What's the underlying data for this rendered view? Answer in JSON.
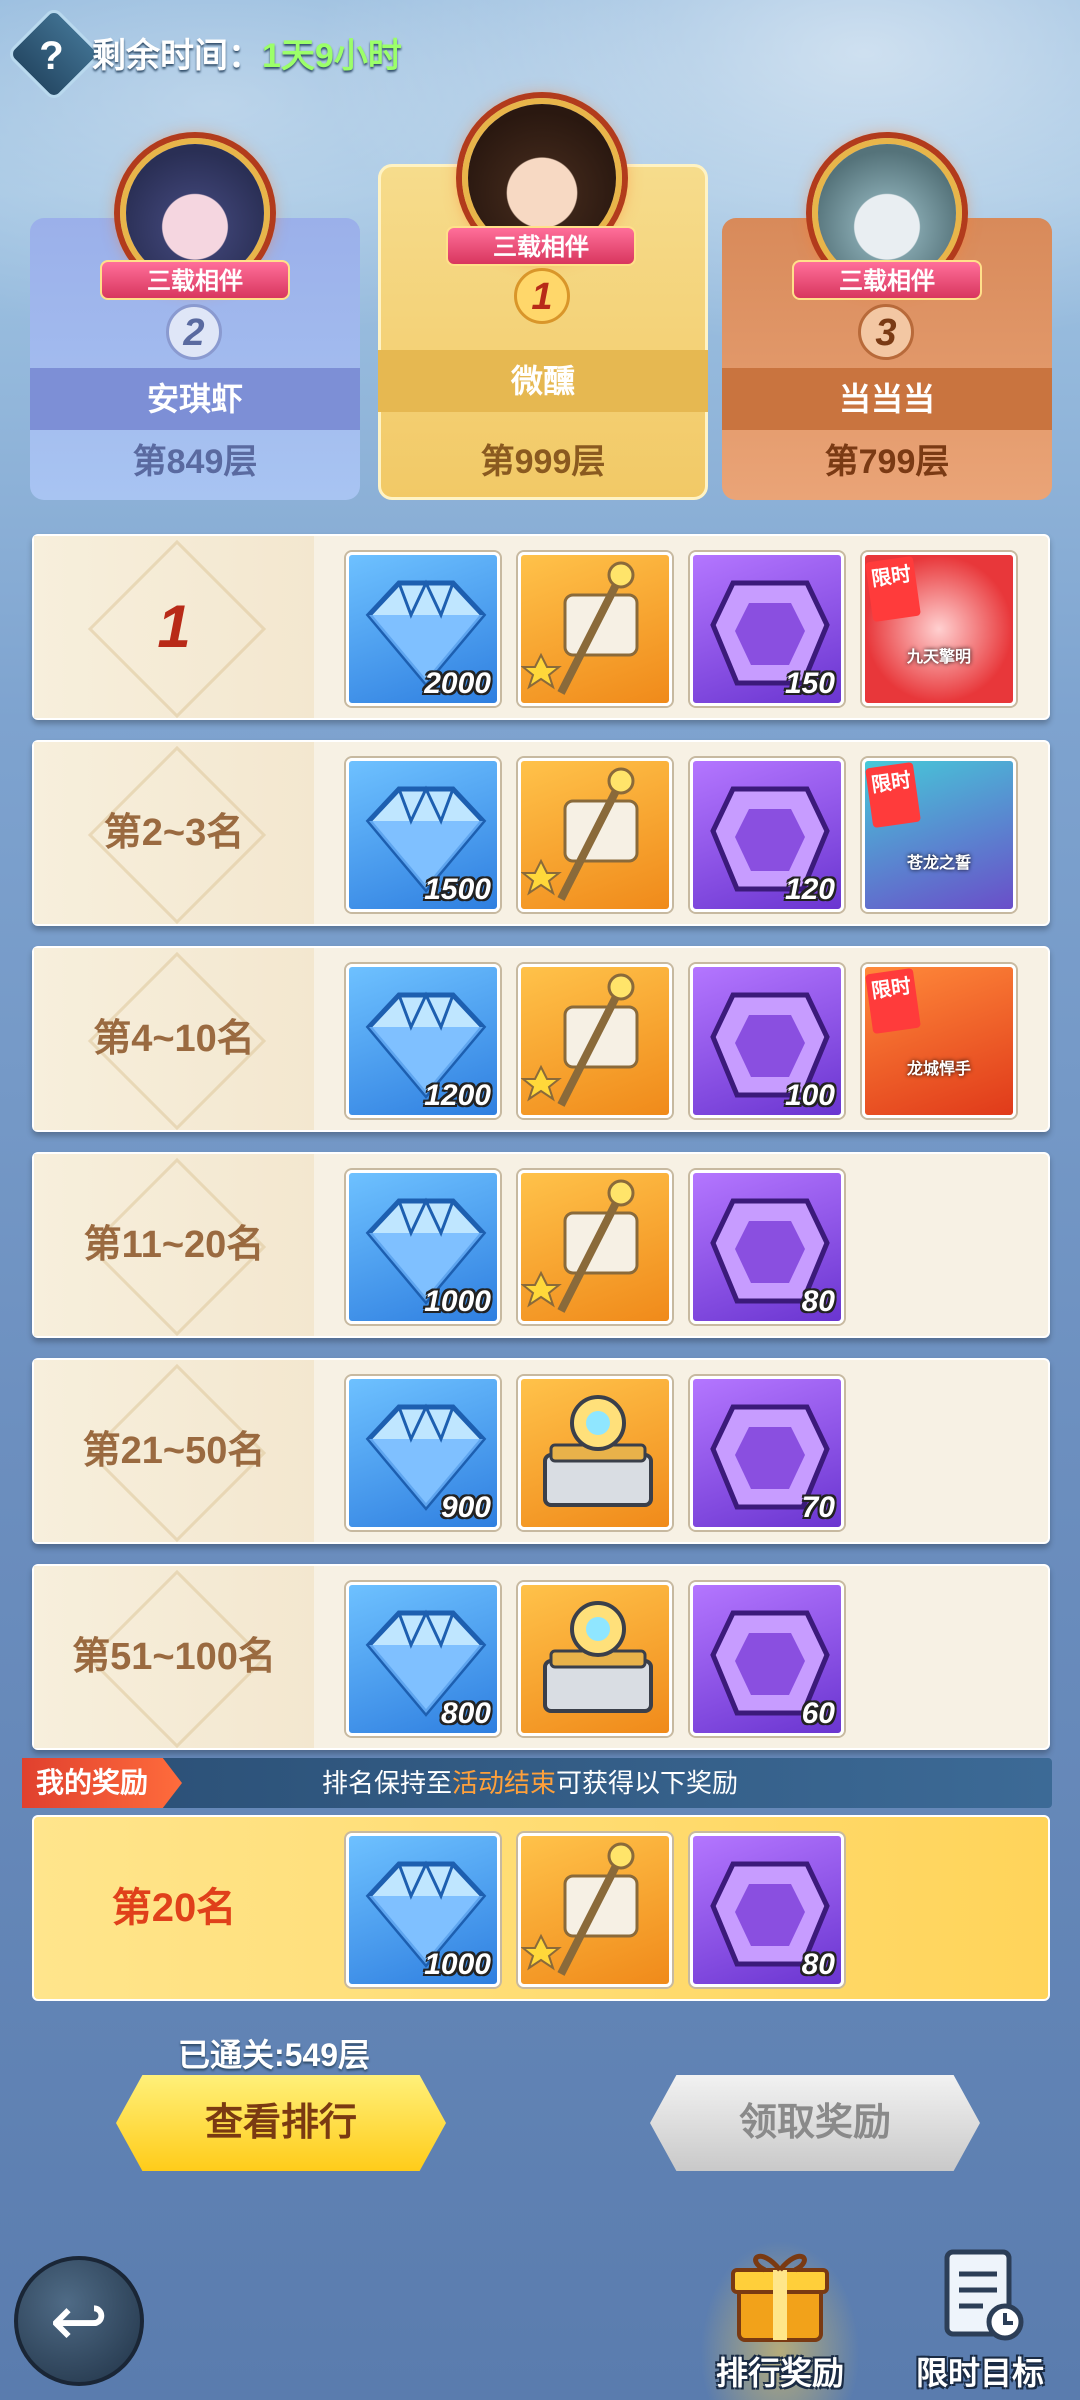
{
  "header": {
    "help_icon": "question-icon",
    "timer_label": "剩余时间：",
    "timer_value": "1天9小时"
  },
  "podium": [
    {
      "rank": "2",
      "banner": "三载相伴",
      "name": "安琪虾",
      "floor": "第849层"
    },
    {
      "rank": "1",
      "banner": "三载相伴",
      "name": "微醺",
      "floor": "第999层"
    },
    {
      "rank": "3",
      "banner": "三载相伴",
      "name": "当当当",
      "floor": "第799层"
    }
  ],
  "rewards": [
    {
      "rank_label": "1",
      "items": [
        {
          "kind": "diamond",
          "count": "2000"
        },
        {
          "kind": "scroll-staff",
          "count": ""
        },
        {
          "kind": "purple-gem",
          "count": "150"
        },
        {
          "kind": "limited-title",
          "tag": "限时",
          "caption": "九天擎明"
        }
      ]
    },
    {
      "rank_label": "第2~3名",
      "items": [
        {
          "kind": "diamond",
          "count": "1500"
        },
        {
          "kind": "scroll-staff",
          "count": ""
        },
        {
          "kind": "purple-gem",
          "count": "120"
        },
        {
          "kind": "limited-title",
          "tag": "限时",
          "caption": "苍龙之誓"
        }
      ]
    },
    {
      "rank_label": "第4~10名",
      "items": [
        {
          "kind": "diamond",
          "count": "1200"
        },
        {
          "kind": "scroll-staff",
          "count": ""
        },
        {
          "kind": "purple-gem",
          "count": "100"
        },
        {
          "kind": "limited-title",
          "tag": "限时",
          "caption": "龙城悍手"
        }
      ]
    },
    {
      "rank_label": "第11~20名",
      "items": [
        {
          "kind": "diamond",
          "count": "1000"
        },
        {
          "kind": "scroll-staff",
          "count": ""
        },
        {
          "kind": "purple-gem",
          "count": "80"
        }
      ]
    },
    {
      "rank_label": "第21~50名",
      "items": [
        {
          "kind": "diamond",
          "count": "900"
        },
        {
          "kind": "chest",
          "count": ""
        },
        {
          "kind": "purple-gem",
          "count": "70"
        }
      ]
    },
    {
      "rank_label": "第51~100名",
      "items": [
        {
          "kind": "diamond",
          "count": "800"
        },
        {
          "kind": "chest",
          "count": ""
        },
        {
          "kind": "purple-gem",
          "count": "60"
        }
      ]
    }
  ],
  "my_reward": {
    "tag": "我的奖励",
    "note_prefix": "排名保持至",
    "note_highlight": "活动结束",
    "note_suffix": "可获得以下奖励",
    "rank_label": "第20名",
    "items": [
      {
        "kind": "diamond",
        "count": "1000"
      },
      {
        "kind": "scroll-staff",
        "count": ""
      },
      {
        "kind": "purple-gem",
        "count": "80"
      }
    ]
  },
  "progress": {
    "cleared": "已通关:549层"
  },
  "buttons": {
    "view_ranking": "查看排行",
    "claim_reward": "领取奖励"
  },
  "bottom_nav": {
    "back_icon": "back-arrow-icon",
    "tabs": [
      {
        "label": "排行奖励"
      },
      {
        "label": "限时目标"
      }
    ]
  },
  "colors": {
    "accent_green": "#9cff6a",
    "highlight_orange": "#ffa03a",
    "my_rank_red": "#e0401a"
  }
}
